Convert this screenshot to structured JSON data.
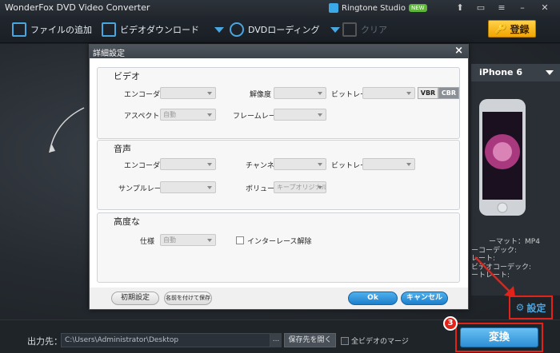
{
  "window": {
    "title": "WonderFox DVD Video Converter",
    "ringtone_label": "Ringtone Studio",
    "new_badge": "NEW",
    "buttons": [
      "upload-icon",
      "chat-icon",
      "menu-icon",
      "minimize-icon",
      "close-icon"
    ]
  },
  "toolbar": {
    "add_file": "ファイルの追加",
    "video_download": "ビデオダウンロード",
    "dvd_loading": "DVDローディング",
    "clear": "クリア",
    "register": "登録"
  },
  "device": {
    "name": "iPhone 6",
    "info": [
      "ーマット：MP4",
      "ーコーデック:",
      "レート:",
      "ビデオコーデック:",
      "ートレート:"
    ]
  },
  "settings_link": "設定",
  "bottom": {
    "output_label": "出力先：",
    "output_path": "C:\\Users\\Administrator\\Desktop",
    "browse": "...",
    "open_folder": "保存先を開く",
    "merge_all": "全ビデオのマージ",
    "convert": "変換",
    "step_number": "3"
  },
  "dialog": {
    "title": "詳細設定",
    "video": {
      "title": "ビデオ",
      "encoder": "エンコーダー",
      "resolution": "解像度",
      "bitrate": "ビットレート",
      "vbr": "VBR",
      "cbr": "CBR",
      "aspect": "アスペクト比",
      "aspect_value": "自動",
      "framerate": "フレームレート"
    },
    "audio": {
      "title": "音声",
      "encoder": "エンコーダー",
      "channel": "チャンネル",
      "bitrate": "ビットレート",
      "samplerate": "サンプルレート",
      "volume": "ボリューム",
      "volume_value": "キープオリジナル"
    },
    "advanced": {
      "title": "高度な",
      "spec": "仕様",
      "spec_value": "自動",
      "deinterlace": "インターレース解除"
    },
    "footer": {
      "reset": "初期設定",
      "save_as": "名前を付けて保存",
      "ok": "Ok",
      "cancel": "キャンセル"
    }
  },
  "colors": {
    "accent_blue": "#2d8fd6",
    "highlight_red": "#e2231a",
    "register_yellow": "#f2a400"
  }
}
